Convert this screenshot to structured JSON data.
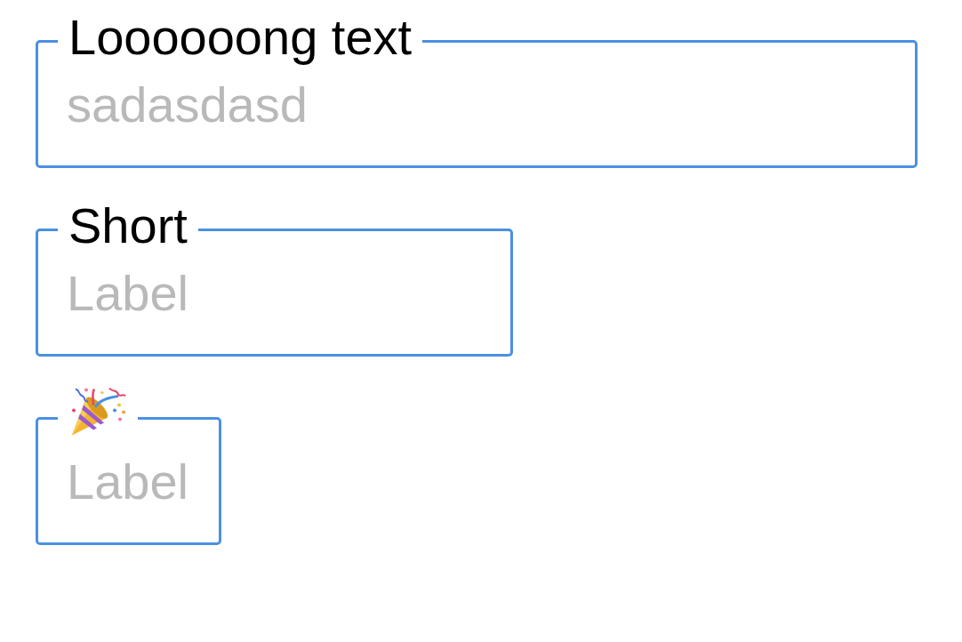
{
  "fields": [
    {
      "kind": "text",
      "label": "Loooooong text",
      "placeholder": "sadasdasd"
    },
    {
      "kind": "text",
      "label": "Short",
      "placeholder": "Label"
    },
    {
      "kind": "icon",
      "placeholder": "Label"
    }
  ]
}
